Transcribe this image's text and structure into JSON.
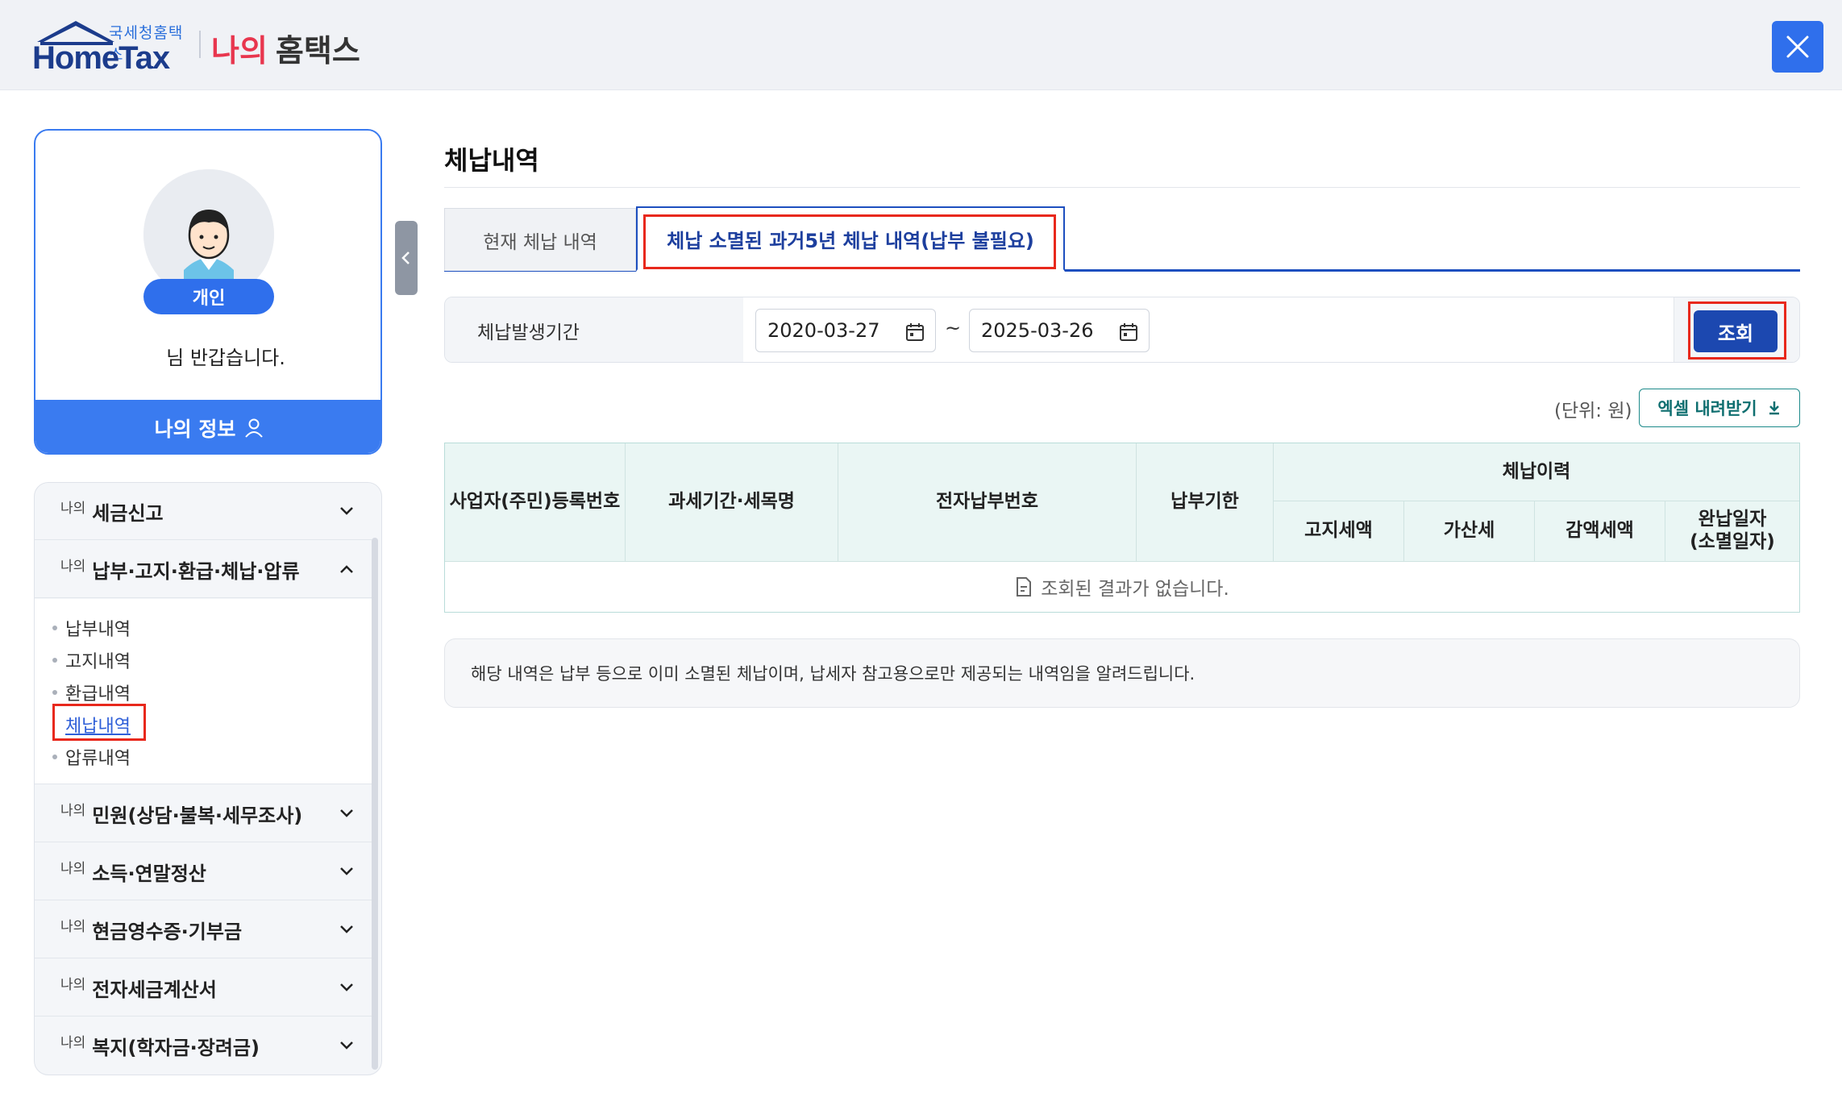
{
  "header": {
    "logo_sub": "국세청홈택스",
    "logo_main": "HomeTax",
    "brand_prefix": "나의",
    "brand_title": "홈택스",
    "close_label": "close",
    "accent_color": "#2f6fec"
  },
  "profile": {
    "badge": "개인",
    "greeting": "님 반갑습니다.",
    "myinfo_label": "나의 정보"
  },
  "sidebar": {
    "items": [
      {
        "prefix": "나의",
        "label": "세금신고",
        "expanded": false
      },
      {
        "prefix": "나의",
        "label": "납부·고지·환급·체납·압류",
        "expanded": true
      },
      {
        "prefix": "나의",
        "label": "민원(상담·불복·세무조사)",
        "expanded": false
      },
      {
        "prefix": "나의",
        "label": "소득·연말정산",
        "expanded": false
      },
      {
        "prefix": "나의",
        "label": "현금영수증·기부금",
        "expanded": false
      },
      {
        "prefix": "나의",
        "label": "전자세금계산서",
        "expanded": false
      },
      {
        "prefix": "나의",
        "label": "복지(학자금·장려금)",
        "expanded": false
      }
    ],
    "submenu": [
      "납부내역",
      "고지내역",
      "환급내역",
      "체납내역",
      "압류내역"
    ],
    "active_submenu": "체납내역"
  },
  "main": {
    "title": "체납내역",
    "tabs": [
      {
        "label": "현재 체납 내역",
        "active": false
      },
      {
        "label": "체납 소멸된 과거5년 체납 내역(납부 불필요)",
        "active": true
      }
    ],
    "search": {
      "label": "체납발생기간",
      "start_date": "2020-03-27",
      "separator": "~",
      "end_date": "2025-03-26",
      "button_label": "조회"
    },
    "unit_text": "(단위: 원)",
    "excel_label": "엑셀 내려받기",
    "table": {
      "headers": [
        "사업자(주민)등록번호",
        "과세기간·세목명",
        "전자납부번호",
        "납부기한"
      ],
      "group_header": "체납이력",
      "sub_headers": [
        "고지세액",
        "가산세",
        "감액세액",
        "완납일자\n(소멸일자)"
      ],
      "empty_text": "조회된 결과가 없습니다."
    },
    "notice": "해당 내역은 납부 등으로 이미 소멸된 체납이며, 납세자 참고용으로만 제공되는 내역임을 알려드립니다."
  }
}
